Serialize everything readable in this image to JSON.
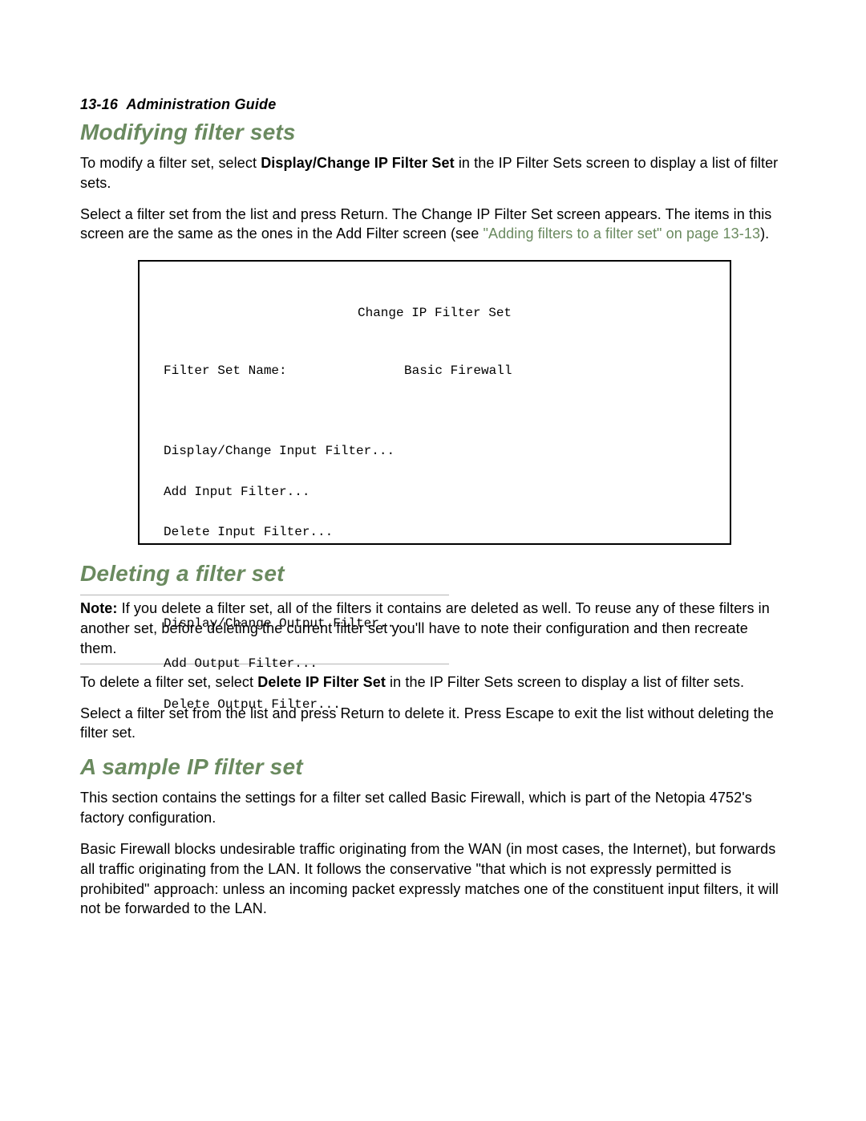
{
  "header": {
    "page_number": "13-16",
    "doc_title": "Administration Guide"
  },
  "section1": {
    "heading": "Modifying filter sets",
    "para1_prefix": "To modify a filter set, select ",
    "para1_bold": "Display/Change IP Filter Set",
    "para1_suffix": " in the IP Filter Sets screen to display a list of filter sets.",
    "para2_prefix": "Select a filter set from the list and press Return. The Change IP Filter Set screen appears. The items in this screen are the same as the ones in the Add Filter screen (see ",
    "para2_link": "\"Adding filters to a filter set\" on page 13-13",
    "para2_suffix": ")."
  },
  "terminal": {
    "title": "Change IP Filter Set",
    "filter_set_name_label": "Filter Set Name:",
    "filter_set_name_value": "Basic Firewall",
    "input_group": [
      "Display/Change Input Filter...",
      "Add Input Filter...",
      "Delete Input Filter..."
    ],
    "output_group": [
      "Display/Change Output Filter...",
      "Add Output Filter...",
      "Delete Output Filter..."
    ]
  },
  "section2": {
    "heading": "Deleting a filter set",
    "note_label": "Note:",
    "note_text": " If you delete a filter set, all of the filters it contains are deleted as well. To reuse any of these filters in another set, before deleting the current filter set you'll have to note their configuration and then recreate them.",
    "para1_prefix": "To delete a filter set, select ",
    "para1_bold": "Delete IP Filter Set",
    "para1_suffix": " in the IP Filter Sets screen to display a list of filter sets.",
    "para2": "Select a filter set from the list and press Return to delete it. Press Escape to exit the list without deleting the filter set."
  },
  "section3": {
    "heading": "A sample IP filter set",
    "para1": "This section contains the settings for a filter set called Basic Firewall, which is part of the Netopia 4752's factory configuration.",
    "para2": "Basic Firewall blocks undesirable traffic originating from the WAN (in most cases, the Internet), but forwards all traffic originating from the LAN. It follows the conservative \"that which is not expressly permitted is prohibited\" approach: unless an incoming packet expressly matches one of the constituent input filters, it will not be forwarded to the LAN."
  }
}
